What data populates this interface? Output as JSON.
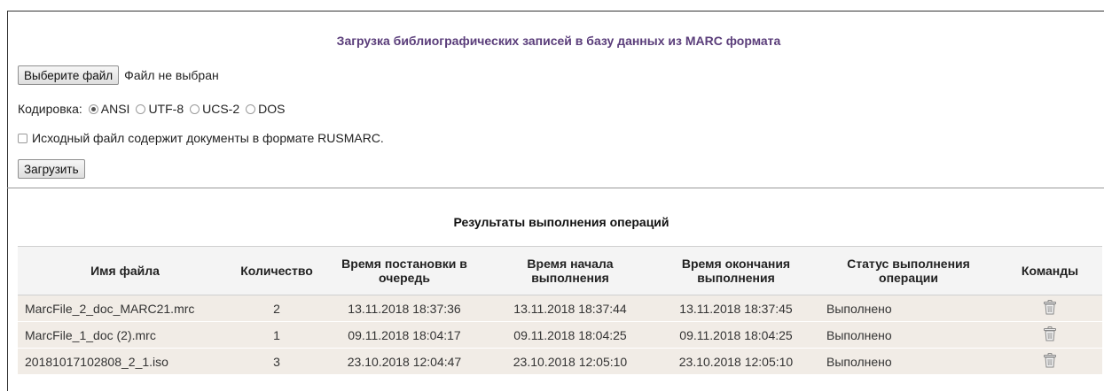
{
  "page": {
    "title": "Загрузка библиографических записей в базу данных из MARC формата"
  },
  "file_picker": {
    "button_label": "Выберите файл",
    "status": "Файл не выбран"
  },
  "encoding": {
    "label": "Кодировка:",
    "options": [
      {
        "label": "ANSI",
        "checked": true
      },
      {
        "label": "UTF-8",
        "checked": false
      },
      {
        "label": "UCS-2",
        "checked": false
      },
      {
        "label": "DOS",
        "checked": false
      }
    ]
  },
  "rusmarc_checkbox": {
    "label": "Исходный файл содержит документы в формате RUSMARC.",
    "checked": false
  },
  "upload_button_label": "Загрузить",
  "results": {
    "title": "Результаты выполнения операций",
    "columns": [
      "Имя файла",
      "Количество",
      "Время постановки в очередь",
      "Время начала выполнения",
      "Время окончания выполнения",
      "Статус выполнения операции",
      "Команды"
    ],
    "rows": [
      {
        "file": "MarcFile_2_doc_MARC21.mrc",
        "count": "2",
        "queued": "13.11.2018 18:37:36",
        "started": "13.11.2018 18:37:44",
        "finished": "13.11.2018 18:37:45",
        "status": "Выполнено",
        "command_icon": "trash-icon"
      },
      {
        "file": "MarcFile_1_doc (2).mrc",
        "count": "1",
        "queued": "09.11.2018 18:04:17",
        "started": "09.11.2018 18:04:25",
        "finished": "09.11.2018 18:04:25",
        "status": "Выполнено",
        "command_icon": "trash-icon"
      },
      {
        "file": "20181017102808_2_1.iso",
        "count": "3",
        "queued": "23.10.2018 12:04:47",
        "started": "23.10.2018 12:05:10",
        "finished": "23.10.2018 12:05:10",
        "status": "Выполнено",
        "command_icon": "trash-icon"
      }
    ]
  },
  "colors": {
    "title": "#5a3d7a",
    "row_background": "#f1ece6",
    "header_background": "#f4f4f4"
  }
}
